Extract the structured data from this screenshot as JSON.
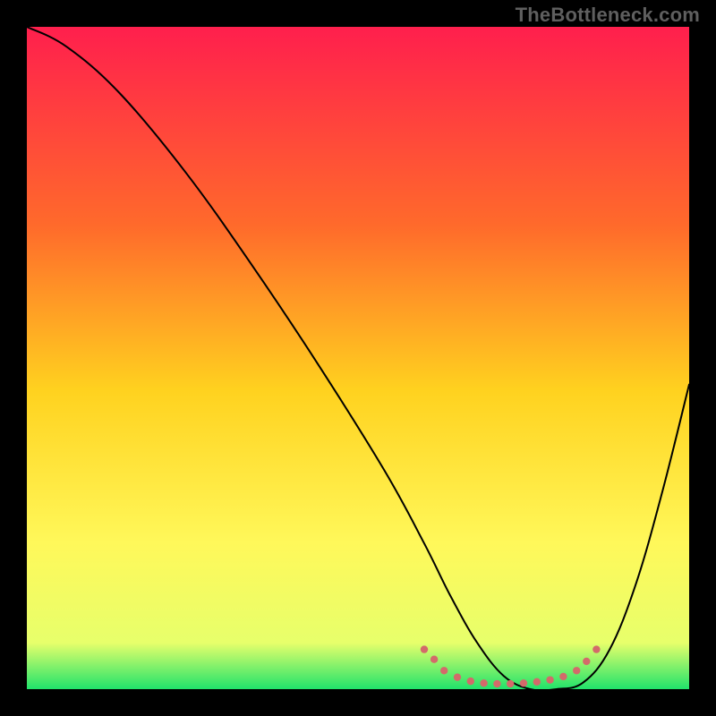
{
  "watermark": "TheBottleneck.com",
  "chart_data": {
    "type": "line",
    "title": "",
    "xlabel": "",
    "ylabel": "",
    "xlim": [
      0,
      100
    ],
    "ylim": [
      0,
      100
    ],
    "gradient_stops": [
      {
        "offset": 0,
        "color": "#ff1f4d"
      },
      {
        "offset": 30,
        "color": "#ff6a2b"
      },
      {
        "offset": 55,
        "color": "#ffd21f"
      },
      {
        "offset": 78,
        "color": "#fff85a"
      },
      {
        "offset": 93,
        "color": "#e7ff6b"
      },
      {
        "offset": 100,
        "color": "#21e36b"
      }
    ],
    "series": [
      {
        "name": "bottleneck-curve",
        "color": "#000000",
        "x": [
          0,
          6,
          14,
          24,
          34,
          44,
          54,
          60,
          64,
          68,
          72,
          76,
          80,
          84,
          88,
          92,
          96,
          100
        ],
        "values": [
          100,
          97,
          90,
          78,
          64,
          49,
          33,
          22,
          14,
          7,
          2,
          0,
          0,
          1,
          6,
          16,
          30,
          46
        ]
      },
      {
        "name": "optimal-band",
        "color": "#d36a6a",
        "style": "dotted",
        "x": [
          60,
          61.5,
          63,
          65,
          67,
          69,
          71,
          73,
          75,
          77,
          79,
          81,
          83,
          84.5,
          86
        ],
        "values": [
          6.0,
          4.5,
          2.8,
          1.8,
          1.2,
          0.9,
          0.8,
          0.8,
          0.9,
          1.1,
          1.4,
          1.9,
          2.8,
          4.2,
          6.0
        ]
      }
    ]
  }
}
